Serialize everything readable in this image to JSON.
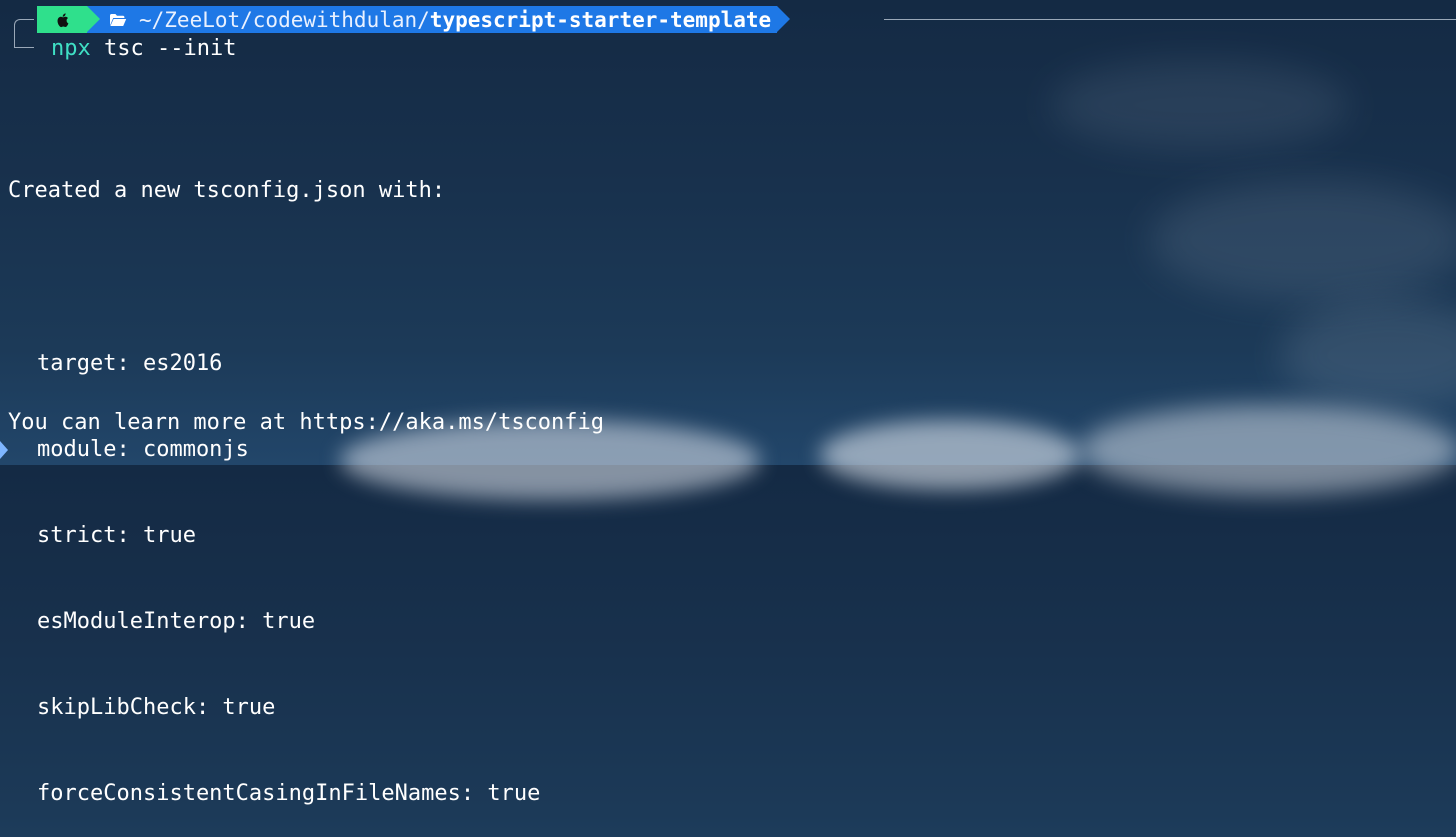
{
  "prompt": {
    "os_icon": "apple-icon",
    "folder_icon": "folder-open-icon",
    "path_prefix": "~/ZeeLot/codewithdulan/",
    "path_current": "typescript-starter-template",
    "os_segment_color": "#2fe08c",
    "path_segment_color": "#1e78e6"
  },
  "command": {
    "name": "npx",
    "args": " tsc --init"
  },
  "output": {
    "created_message": "Created a new tsconfig.json with:",
    "options": [
      "target: es2016",
      "module: commonjs",
      "strict: true",
      "esModuleInterop: true",
      "skipLibCheck: true",
      "forceConsistentCasingInFileNames: true"
    ],
    "learn_more": "You can learn more at https://aka.ms/tsconfig"
  },
  "colors": {
    "command_name": "#3fe0c5",
    "text": "#ffffff",
    "background": "#18314d"
  }
}
